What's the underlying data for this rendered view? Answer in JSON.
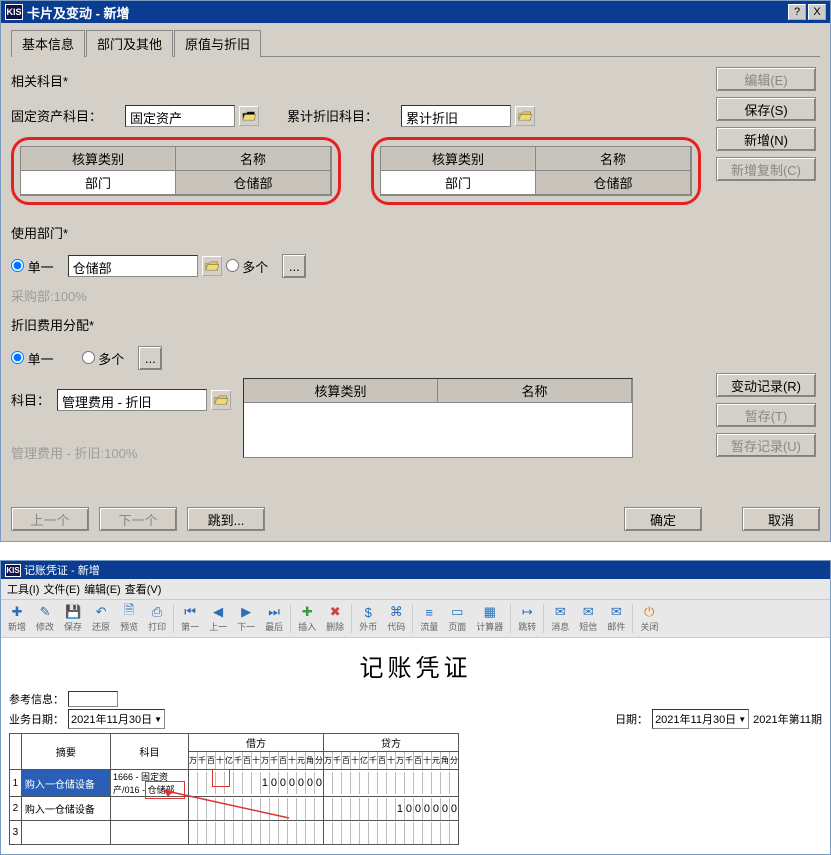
{
  "win1": {
    "icon": "KIS",
    "title": "卡片及变动 - 新增",
    "help": "?",
    "close": "X",
    "tabs": [
      "基本信息",
      "部门及其他",
      "原值与折旧"
    ],
    "related_label": "相关科目*",
    "fixed_asset_label": "固定资产科目：",
    "fixed_asset_value": "固定资产",
    "accum_dep_label": "累计折旧科目：",
    "accum_dep_value": "累计折旧",
    "mini_headers": [
      "核算类别",
      "名称"
    ],
    "mini_row": [
      "部门",
      "仓储部"
    ],
    "use_dept_label": "使用部门*",
    "single": "单一",
    "multi": "多个",
    "use_dept_value": "仓储部",
    "purchase_note": "采购部:100%",
    "dep_alloc_label": "折旧费用分配*",
    "subject_label": "科目：",
    "subject_value": "管理费用 - 折旧",
    "mgmt_note": "管理费用 - 折旧:100%",
    "btns": {
      "edit": "编辑(E)",
      "save": "保存(S)",
      "new": "新增(N)",
      "newcopy": "新增复制(C)",
      "changelog": "变动记录(R)",
      "tempstore": "暂存(T)",
      "templog": "暂存记录(U)",
      "prev": "上一个",
      "next": "下一个",
      "jumpto": "跳到...",
      "ok": "确定",
      "cancel": "取消"
    }
  },
  "win2": {
    "icon": "KIS",
    "title": "记账凭证 - 新增",
    "menus": [
      "工具(I)",
      "文件(E)",
      "编辑(E)",
      "查看(V)"
    ],
    "toolbar": [
      {
        "label": "新增",
        "icon": "✚"
      },
      {
        "label": "修改",
        "icon": "✎"
      },
      {
        "label": "保存",
        "icon": "💾"
      },
      {
        "label": "还原",
        "icon": "↶"
      },
      {
        "label": "预览",
        "icon": "🗎"
      },
      {
        "label": "打印",
        "icon": "⎙"
      },
      {
        "sep": true
      },
      {
        "label": "第一",
        "icon": "⏮"
      },
      {
        "label": "上一",
        "icon": "◀"
      },
      {
        "label": "下一",
        "icon": "▶"
      },
      {
        "label": "最后",
        "icon": "⏭"
      },
      {
        "sep": true
      },
      {
        "label": "插入",
        "icon": "✚"
      },
      {
        "label": "删除",
        "icon": "✖"
      },
      {
        "sep": true
      },
      {
        "label": "外币",
        "icon": "$"
      },
      {
        "label": "代码",
        "icon": "⌘"
      },
      {
        "sep": true
      },
      {
        "label": "流量",
        "icon": "≡"
      },
      {
        "label": "页面",
        "icon": "▭"
      },
      {
        "label": "计算器",
        "icon": "▦"
      },
      {
        "sep": true
      },
      {
        "label": "跳转",
        "icon": "↦"
      },
      {
        "sep": true
      },
      {
        "label": "消息",
        "icon": "✉"
      },
      {
        "label": "短信",
        "icon": "✉"
      },
      {
        "label": "邮件",
        "icon": "✉"
      },
      {
        "sep": true
      },
      {
        "label": "关闭",
        "icon": "⏻"
      }
    ],
    "doc_title": "记账凭证",
    "ref_label": "参考信息：",
    "biz_date_label": "业务日期：",
    "biz_date_value": "2021年11月30日",
    "date_label": "日期：",
    "date_value": "2021年11月30日",
    "period": "2021年第11期",
    "headers": {
      "summary": "摘要",
      "subject": "科目",
      "debit": "借方",
      "credit": "贷方"
    },
    "digit_labels": [
      "万",
      "千",
      "百",
      "十",
      "亿",
      "千",
      "百",
      "十",
      "万",
      "千",
      "百",
      "十",
      "元",
      "角",
      "分"
    ],
    "rows": [
      {
        "n": "1",
        "summary": "购入一仓储设备",
        "subject": "1666 - 固定资产/016 - 仓储部",
        "debit": "1000000",
        "credit": ""
      },
      {
        "n": "2",
        "summary": "购入一仓储设备",
        "subject": "",
        "debit": "",
        "credit": "1000000"
      },
      {
        "n": "3",
        "summary": "",
        "subject": "",
        "debit": "",
        "credit": ""
      }
    ]
  }
}
